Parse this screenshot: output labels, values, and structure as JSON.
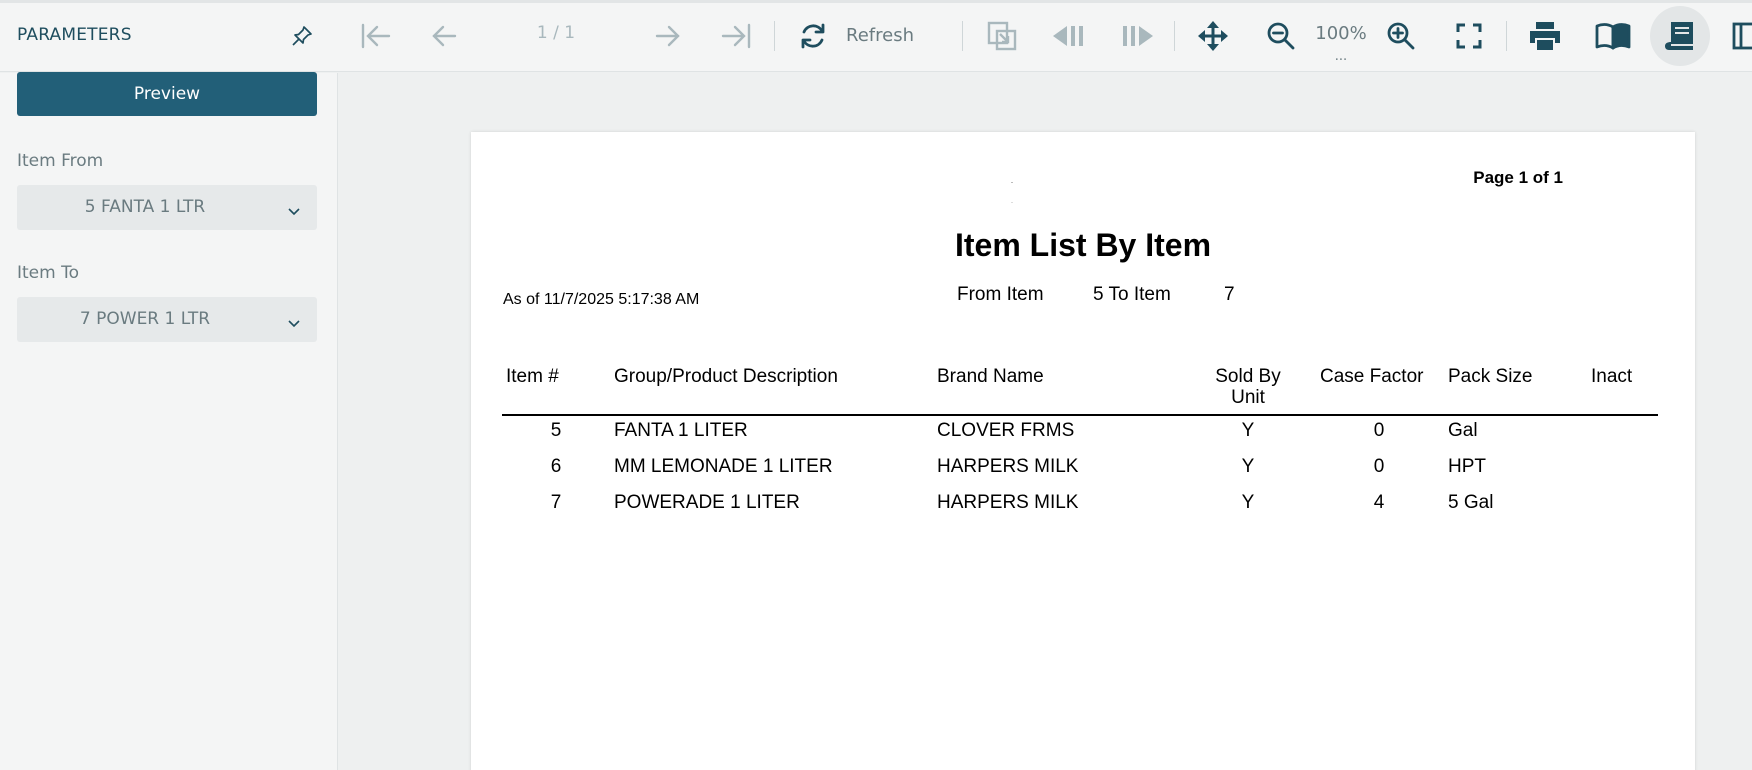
{
  "toolbar": {
    "parameters_title": "PARAMETERS",
    "page_indicator": "1 / 1",
    "refresh_label": "Refresh",
    "zoom_level": "100%",
    "zoom_more": "...",
    "icons": [
      "pin-icon",
      "first-page-icon",
      "previous-page-icon",
      "next-page-icon",
      "last-page-icon",
      "refresh-icon",
      "export-icon",
      "previous-section-icon",
      "next-section-icon",
      "pan-icon",
      "zoom-out-icon",
      "zoom-in-icon",
      "fit-screen-icon",
      "print-icon",
      "book-view-icon",
      "continuous-view-icon",
      "side-view-icon"
    ]
  },
  "parameters": {
    "preview_label": "Preview",
    "item_from_label": "Item From",
    "item_from_value": "5 FANTA 1 LTR",
    "item_to_label": "Item To",
    "item_to_value": "7 POWER 1 LTR"
  },
  "report": {
    "page_number": "Page 1 of 1",
    "title": "Item List By Item",
    "as_of": "As of 11/7/2025 5:17:38 AM",
    "from_item_label": "From Item",
    "to_item_label": "5 To Item",
    "to_item_value": "7",
    "columns": {
      "item_no": "Item #",
      "description": "Group/Product Description",
      "brand": "Brand Name",
      "sold_by_unit": "Sold By",
      "sold_by_unit_2": "Unit",
      "case_factor": "Case Factor",
      "pack_size": "Pack Size",
      "inact": "Inact"
    },
    "rows": [
      {
        "item_no": "5",
        "description": "FANTA 1 LITER",
        "brand": "CLOVER FRMS",
        "sold_by_unit": "Y",
        "case_factor": "0",
        "pack_size": "Gal"
      },
      {
        "item_no": "6",
        "description": "MM LEMONADE 1 LITER",
        "brand": "HARPERS MILK",
        "sold_by_unit": "Y",
        "case_factor": "0",
        "pack_size": "HPT"
      },
      {
        "item_no": "7",
        "description": "POWERADE 1 LITER",
        "brand": "HARPERS MILK",
        "sold_by_unit": "Y",
        "case_factor": "4",
        "pack_size": "5 Gal"
      }
    ]
  },
  "colors": {
    "accent": "#225f78",
    "icon": "#1e4d5e",
    "disabled_icon": "#a9b8bd"
  }
}
